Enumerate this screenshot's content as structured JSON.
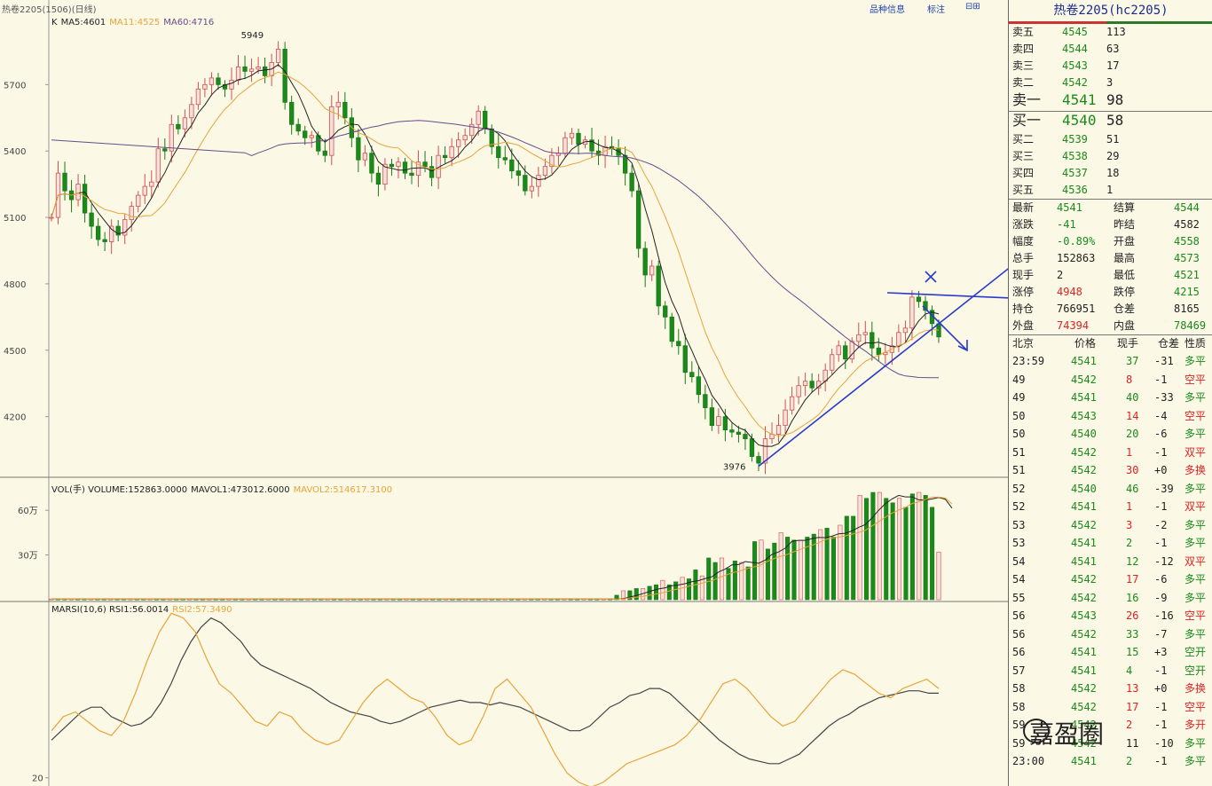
{
  "topbar": {
    "title": "热卷2205(1506)(日线)",
    "btn_product": "品种信息",
    "btn_sign": "标注",
    "btn_icons": "⊟⊞"
  },
  "legends": {
    "price": [
      {
        "text": "K",
        "color": "#222222"
      },
      {
        "text": "MA5:4601",
        "color": "#222222"
      },
      {
        "text": "MA11:4525",
        "color": "#e8a33a"
      },
      {
        "text": "MA60:4716",
        "color": "#6a4a8a"
      }
    ],
    "volume": [
      {
        "text": "VOL(手) VOLUME:152863.0000",
        "color": "#222222"
      },
      {
        "text": "MAVOL1:473012.6000",
        "color": "#222222"
      },
      {
        "text": "MAVOL2:514617.3100",
        "color": "#e8a33a"
      }
    ],
    "rsi": [
      {
        "text": "MARSI(10,6) RSI1:56.0014",
        "color": "#222222"
      },
      {
        "text": "RSI2:57.3490",
        "color": "#e8a33a"
      }
    ]
  },
  "price_ticks": [
    "5700",
    "5400",
    "5100",
    "4800",
    "4500",
    "4200"
  ],
  "volume_ticks": [
    "60万",
    "30万"
  ],
  "rsi_ticks": [
    "20"
  ],
  "annotations": {
    "high": "5949",
    "low": "3976"
  },
  "chart_data": [
    {
      "type": "candlestick",
      "title": "热卷2205(1506)(日线)",
      "ylim": [
        3930,
        6010
      ],
      "y_ticks": [
        5700,
        5400,
        5100,
        4800,
        4500,
        4200
      ],
      "close": [
        5100,
        5300,
        5220,
        5180,
        5250,
        5120,
        5060,
        5000,
        4990,
        5060,
        5020,
        5090,
        5150,
        5200,
        5240,
        5260,
        5410,
        5400,
        5520,
        5500,
        5550,
        5610,
        5680,
        5700,
        5730,
        5700,
        5680,
        5720,
        5780,
        5760,
        5770,
        5780,
        5740,
        5800,
        5860,
        5620,
        5520,
        5490,
        5460,
        5470,
        5400,
        5380,
        5600,
        5620,
        5550,
        5460,
        5360,
        5390,
        5300,
        5250,
        5340,
        5330,
        5350,
        5300,
        5290,
        5350,
        5330,
        5280,
        5380,
        5370,
        5420,
        5450,
        5470,
        5520,
        5580,
        5500,
        5420,
        5370,
        5360,
        5310,
        5290,
        5220,
        5240,
        5290,
        5330,
        5380,
        5390,
        5460,
        5480,
        5430,
        5450,
        5400,
        5380,
        5420,
        5410,
        5380,
        5300,
        5220,
        4960,
        4840,
        4880,
        4700,
        4650,
        4540,
        4520,
        4400,
        4380,
        4300,
        4240,
        4160,
        4200,
        4140,
        4130,
        4120,
        4100,
        4020,
        3990,
        4100,
        4120,
        4160,
        4230,
        4290,
        4340,
        4360,
        4330,
        4360,
        4410,
        4480,
        4520,
        4460,
        4540,
        4570,
        4580,
        4510,
        4480,
        4490,
        4520,
        4580,
        4600,
        4740,
        4720,
        4680,
        4620,
        4560
      ],
      "high": 5949,
      "low": 3976,
      "overlays": {
        "MA5": 4601,
        "MA11": 4525,
        "MA60": 4716
      }
    },
    {
      "type": "bar",
      "title": "VOL(手)",
      "ylim": [
        0,
        750000
      ],
      "y_ticks": [
        600000,
        300000
      ],
      "values": [
        5000,
        5000,
        5000,
        5000,
        5000,
        5000,
        5000,
        5000,
        5000,
        5000,
        5000,
        5000,
        5000,
        5000,
        5000,
        5000,
        5000,
        5000,
        5000,
        5000,
        5000,
        5000,
        5000,
        5000,
        5000,
        5000,
        5000,
        5000,
        5000,
        5000,
        5000,
        5000,
        5000,
        5000,
        5000,
        5000,
        5000,
        5000,
        5000,
        5000,
        5000,
        5000,
        5000,
        5000,
        5000,
        5000,
        5000,
        5000,
        5000,
        5000,
        5000,
        5000,
        5000,
        5000,
        5000,
        5000,
        5000,
        5000,
        5000,
        5000,
        5000,
        5000,
        5000,
        5000,
        5000,
        5000,
        5000,
        5000,
        5000,
        5000,
        5000,
        5000,
        5000,
        5000,
        5000,
        5000,
        5000,
        5000,
        5000,
        5000,
        5000,
        5000,
        5000,
        5000,
        5000,
        5000,
        30000,
        60000,
        60000,
        75000,
        75000,
        90000,
        100000,
        130000,
        100000,
        120000,
        150000,
        140000,
        200000,
        160000,
        280000,
        250000,
        280000,
        210000,
        260000,
        250000,
        220000,
        390000,
        400000,
        340000,
        380000,
        450000,
        420000,
        400000,
        400000,
        420000,
        440000,
        470000,
        480000,
        420000,
        500000,
        560000,
        560000,
        700000,
        680000,
        720000,
        720000,
        680000,
        650000,
        680000,
        620000,
        710000,
        720000,
        700000,
        620000,
        320000
      ],
      "overlays": {
        "VOLUME": 152863,
        "MAVOL1": 473012.6,
        "MAVOL2": 514617.31
      }
    },
    {
      "type": "line",
      "title": "MARSI(10,6)",
      "y_ticks": [
        20
      ],
      "ylim": [
        18,
        92
      ],
      "series": [
        {
          "name": "RSI1",
          "values": [
            36,
            40,
            44,
            48,
            50,
            50,
            46,
            44,
            42,
            43,
            46,
            52,
            60,
            70,
            78,
            84,
            88,
            86,
            82,
            78,
            72,
            68,
            66,
            64,
            62,
            60,
            58,
            55,
            52,
            50,
            48,
            47,
            46,
            44,
            43,
            44,
            46,
            48,
            50,
            51,
            52,
            53,
            52,
            52,
            51,
            52,
            51,
            50,
            48,
            46,
            44,
            42,
            40,
            40,
            42,
            46,
            50,
            52,
            55,
            56,
            58,
            58,
            56,
            52,
            48,
            44,
            40,
            36,
            33,
            30,
            28,
            27,
            26,
            26,
            28,
            30,
            34,
            38,
            42,
            45,
            47,
            50,
            52,
            54,
            55,
            56,
            57,
            57,
            56,
            56
          ]
        },
        {
          "name": "RSI2",
          "values": [
            40,
            46,
            48,
            44,
            40,
            38,
            44,
            56,
            70,
            82,
            90,
            88,
            82,
            70,
            60,
            56,
            50,
            44,
            42,
            48,
            46,
            40,
            36,
            34,
            36,
            44,
            52,
            58,
            62,
            58,
            54,
            52,
            46,
            38,
            34,
            36,
            46,
            58,
            62,
            56,
            50,
            40,
            30,
            22,
            18,
            16,
            18,
            22,
            26,
            28,
            30,
            32,
            34,
            38,
            44,
            52,
            60,
            62,
            58,
            52,
            46,
            42,
            44,
            50,
            56,
            62,
            66,
            64,
            60,
            56,
            54,
            58,
            60,
            62,
            58
          ]
        }
      ],
      "overlays": {
        "RSI1": 56.0014,
        "RSI2": 57.349
      }
    }
  ],
  "panel": {
    "title": "热卷2205(hc2205)",
    "asks": [
      {
        "label": "卖五",
        "price": "4545",
        "vol": "113"
      },
      {
        "label": "卖四",
        "price": "4544",
        "vol": "63"
      },
      {
        "label": "卖三",
        "price": "4543",
        "vol": "17"
      },
      {
        "label": "卖二",
        "price": "4542",
        "vol": "3"
      },
      {
        "label": "卖一",
        "price": "4541",
        "vol": "98"
      }
    ],
    "bids": [
      {
        "label": "买一",
        "price": "4540",
        "vol": "58"
      },
      {
        "label": "买二",
        "price": "4539",
        "vol": "51"
      },
      {
        "label": "买三",
        "price": "4538",
        "vol": "29"
      },
      {
        "label": "买四",
        "price": "4537",
        "vol": "18"
      },
      {
        "label": "买五",
        "price": "4536",
        "vol": "1"
      }
    ],
    "stats": [
      {
        "l1": "最新",
        "v1": "4541",
        "c1": "g",
        "l2": "结算",
        "v2": "4544",
        "c2": "g"
      },
      {
        "l1": "涨跌",
        "v1": "-41",
        "c1": "g",
        "l2": "昨结",
        "v2": "4582",
        "c2": "b"
      },
      {
        "l1": "幅度",
        "v1": "-0.89%",
        "c1": "g",
        "l2": "开盘",
        "v2": "4558",
        "c2": "g"
      },
      {
        "l1": "总手",
        "v1": "152863",
        "c1": "b",
        "l2": "最高",
        "v2": "4573",
        "c2": "g"
      },
      {
        "l1": "现手",
        "v1": "2",
        "c1": "b",
        "l2": "最低",
        "v2": "4521",
        "c2": "g"
      },
      {
        "l1": "涨停",
        "v1": "4948",
        "c1": "r",
        "l2": "跌停",
        "v2": "4215",
        "c2": "g"
      },
      {
        "l1": "持仓",
        "v1": "766951",
        "c1": "b",
        "l2": "仓差",
        "v2": "8165",
        "c2": "b"
      },
      {
        "l1": "外盘",
        "v1": "74394",
        "c1": "r",
        "l2": "内盘",
        "v2": "78469",
        "c2": "g"
      }
    ],
    "ticks_header": {
      "time": "北京",
      "price": "价格",
      "vol": "现手",
      "oi": "仓差",
      "nature": "性质"
    },
    "ticks": [
      {
        "time": "23:59",
        "price": "4541",
        "vol": "37",
        "vc": "g",
        "oi": "-31",
        "nature": "多平",
        "nc": "g"
      },
      {
        "time": "49",
        "price": "4542",
        "vol": "8",
        "vc": "r",
        "oi": "-1",
        "nature": "空平",
        "nc": "r"
      },
      {
        "time": "49",
        "price": "4541",
        "vol": "40",
        "vc": "g",
        "oi": "-33",
        "nature": "多平",
        "nc": "g"
      },
      {
        "time": "50",
        "price": "4543",
        "vol": "14",
        "vc": "r",
        "oi": "-4",
        "nature": "空平",
        "nc": "r"
      },
      {
        "time": "50",
        "price": "4540",
        "vol": "20",
        "vc": "g",
        "oi": "-6",
        "nature": "多平",
        "nc": "g"
      },
      {
        "time": "51",
        "price": "4542",
        "vol": "1",
        "vc": "r",
        "oi": "-1",
        "nature": "双平",
        "nc": "r"
      },
      {
        "time": "51",
        "price": "4542",
        "vol": "30",
        "vc": "r",
        "oi": "+0",
        "nature": "多换",
        "nc": "r"
      },
      {
        "time": "52",
        "price": "4540",
        "vol": "46",
        "vc": "g",
        "oi": "-39",
        "nature": "多平",
        "nc": "g"
      },
      {
        "time": "52",
        "price": "4541",
        "vol": "1",
        "vc": "r",
        "oi": "-1",
        "nature": "双平",
        "nc": "r"
      },
      {
        "time": "53",
        "price": "4542",
        "vol": "3",
        "vc": "r",
        "oi": "-2",
        "nature": "多平",
        "nc": "g"
      },
      {
        "time": "53",
        "price": "4541",
        "vol": "2",
        "vc": "g",
        "oi": "-1",
        "nature": "多平",
        "nc": "g"
      },
      {
        "time": "54",
        "price": "4541",
        "vol": "12",
        "vc": "g",
        "oi": "-12",
        "nature": "双平",
        "nc": "r"
      },
      {
        "time": "54",
        "price": "4542",
        "vol": "17",
        "vc": "r",
        "oi": "-6",
        "nature": "多平",
        "nc": "g"
      },
      {
        "time": "55",
        "price": "4542",
        "vol": "16",
        "vc": "g",
        "oi": "-9",
        "nature": "多平",
        "nc": "g"
      },
      {
        "time": "56",
        "price": "4543",
        "vol": "26",
        "vc": "r",
        "oi": "-16",
        "nature": "空平",
        "nc": "r"
      },
      {
        "time": "56",
        "price": "4542",
        "vol": "33",
        "vc": "g",
        "oi": "-7",
        "nature": "多平",
        "nc": "g"
      },
      {
        "time": "56",
        "price": "4541",
        "vol": "15",
        "vc": "g",
        "oi": "+3",
        "nature": "空开",
        "nc": "g"
      },
      {
        "time": "57",
        "price": "4541",
        "vol": "4",
        "vc": "g",
        "oi": "-1",
        "nature": "空开",
        "nc": "g"
      },
      {
        "time": "58",
        "price": "4542",
        "vol": "13",
        "vc": "r",
        "oi": "+0",
        "nature": "多换",
        "nc": "r"
      },
      {
        "time": "58",
        "price": "4542",
        "vol": "17",
        "vc": "r",
        "oi": "-1",
        "nature": "空平",
        "nc": "r"
      },
      {
        "time": "59",
        "price": "4542",
        "vol": "2",
        "vc": "r",
        "oi": "-1",
        "nature": "多开",
        "nc": "r"
      },
      {
        "time": "59",
        "price": "4542",
        "vol": "11",
        "vc": "b",
        "oi": "-10",
        "nature": "多平",
        "nc": "g"
      },
      {
        "time": "23:00",
        "price": "4541",
        "vol": "2",
        "vc": "g",
        "oi": "-1",
        "nature": "多平",
        "nc": "g"
      }
    ]
  },
  "watermark": "嘉盈圈"
}
